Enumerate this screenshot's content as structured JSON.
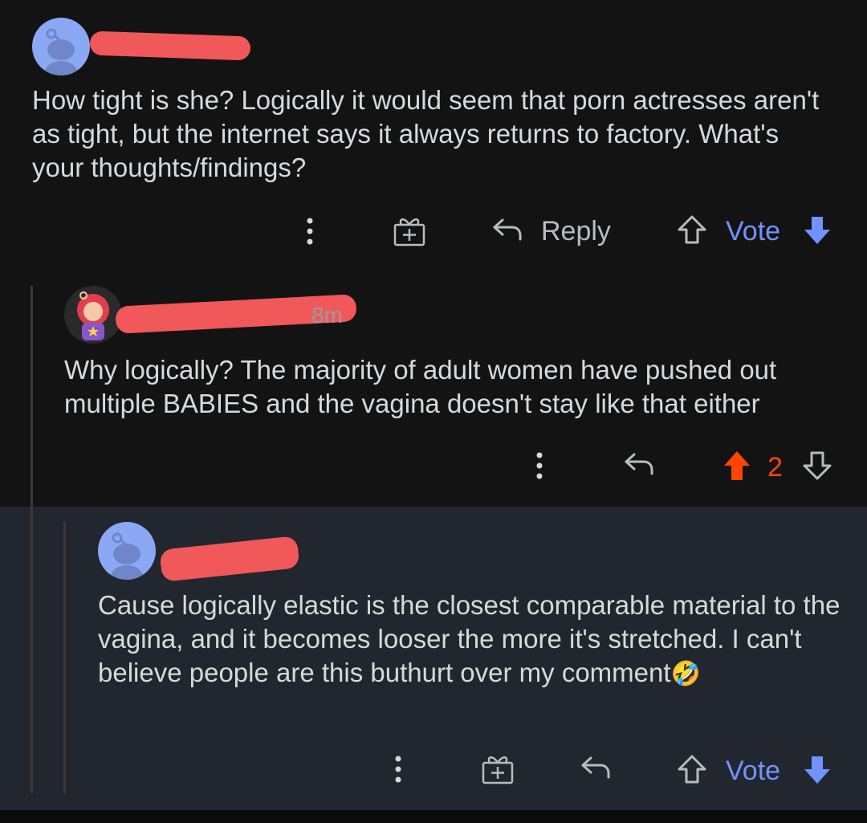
{
  "comments": [
    {
      "body": "How tight is she? Logically it would seem that porn actresses aren't as tight, but the internet says it always returns to factory. What's your thoughts/findings?",
      "actions": {
        "reply_label": "Reply",
        "vote_label": "Vote"
      }
    },
    {
      "time": "8m",
      "body": "Why logically? The majority of adult women have pushed out multiple BABIES and the vagina doesn't stay like that either",
      "score": "2"
    },
    {
      "body": "Cause logically elastic is the closest comparable material to the vagina, and it becomes looser the more it's stretched. I can't believe people are this buthurt over my comment",
      "emoji": "🤣",
      "actions": {
        "vote_label": "Vote"
      }
    }
  ],
  "colors": {
    "background": "#131313",
    "highlight": "#22262e",
    "text": "#d7dadc",
    "vote_blue": "#7193ff",
    "upvote_orange": "#ff4500",
    "redaction": "#f1585a",
    "avatar_blue": "#8ba8f4"
  },
  "icons": [
    "more-options-icon",
    "award-icon",
    "reply-icon",
    "upvote-icon",
    "downvote-icon",
    "snoo-avatar-icon"
  ]
}
